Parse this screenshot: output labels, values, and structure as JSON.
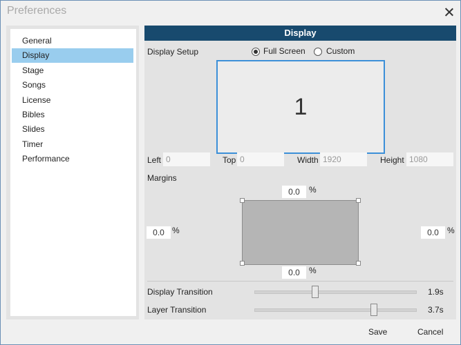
{
  "window": {
    "title": "Preferences"
  },
  "sidebar": {
    "items": [
      {
        "label": "General"
      },
      {
        "label": "Display",
        "active": true
      },
      {
        "label": "Stage"
      },
      {
        "label": "Songs"
      },
      {
        "label": "License"
      },
      {
        "label": "Bibles"
      },
      {
        "label": "Slides"
      },
      {
        "label": "Timer"
      },
      {
        "label": "Performance"
      }
    ]
  },
  "panel": {
    "title": "Display",
    "display_setup": {
      "label": "Display Setup",
      "options": [
        {
          "label": "Full Screen",
          "selected": true
        },
        {
          "label": "Custom",
          "selected": false
        }
      ],
      "monitor_number": "1"
    },
    "position": {
      "left": {
        "label": "Left",
        "value": "0"
      },
      "top": {
        "label": "Top",
        "value": "0"
      },
      "width": {
        "label": "Width",
        "value": "1920"
      },
      "height": {
        "label": "Height",
        "value": "1080"
      }
    },
    "margins": {
      "label": "Margins",
      "top": "0.0",
      "left": "0.0",
      "right": "0.0",
      "bottom": "0.0",
      "unit": "%"
    },
    "transitions": [
      {
        "label": "Display Transition",
        "value": "1.9s",
        "level": 0.38
      },
      {
        "label": "Layer Transition",
        "value": "3.7s",
        "level": 0.74
      }
    ]
  },
  "footer": {
    "save_label": "Save",
    "cancel_label": "Cancel"
  },
  "colors": {
    "header": "#184a6e",
    "selection": "#99cdee",
    "monitor_border": "#3b8fd8"
  }
}
